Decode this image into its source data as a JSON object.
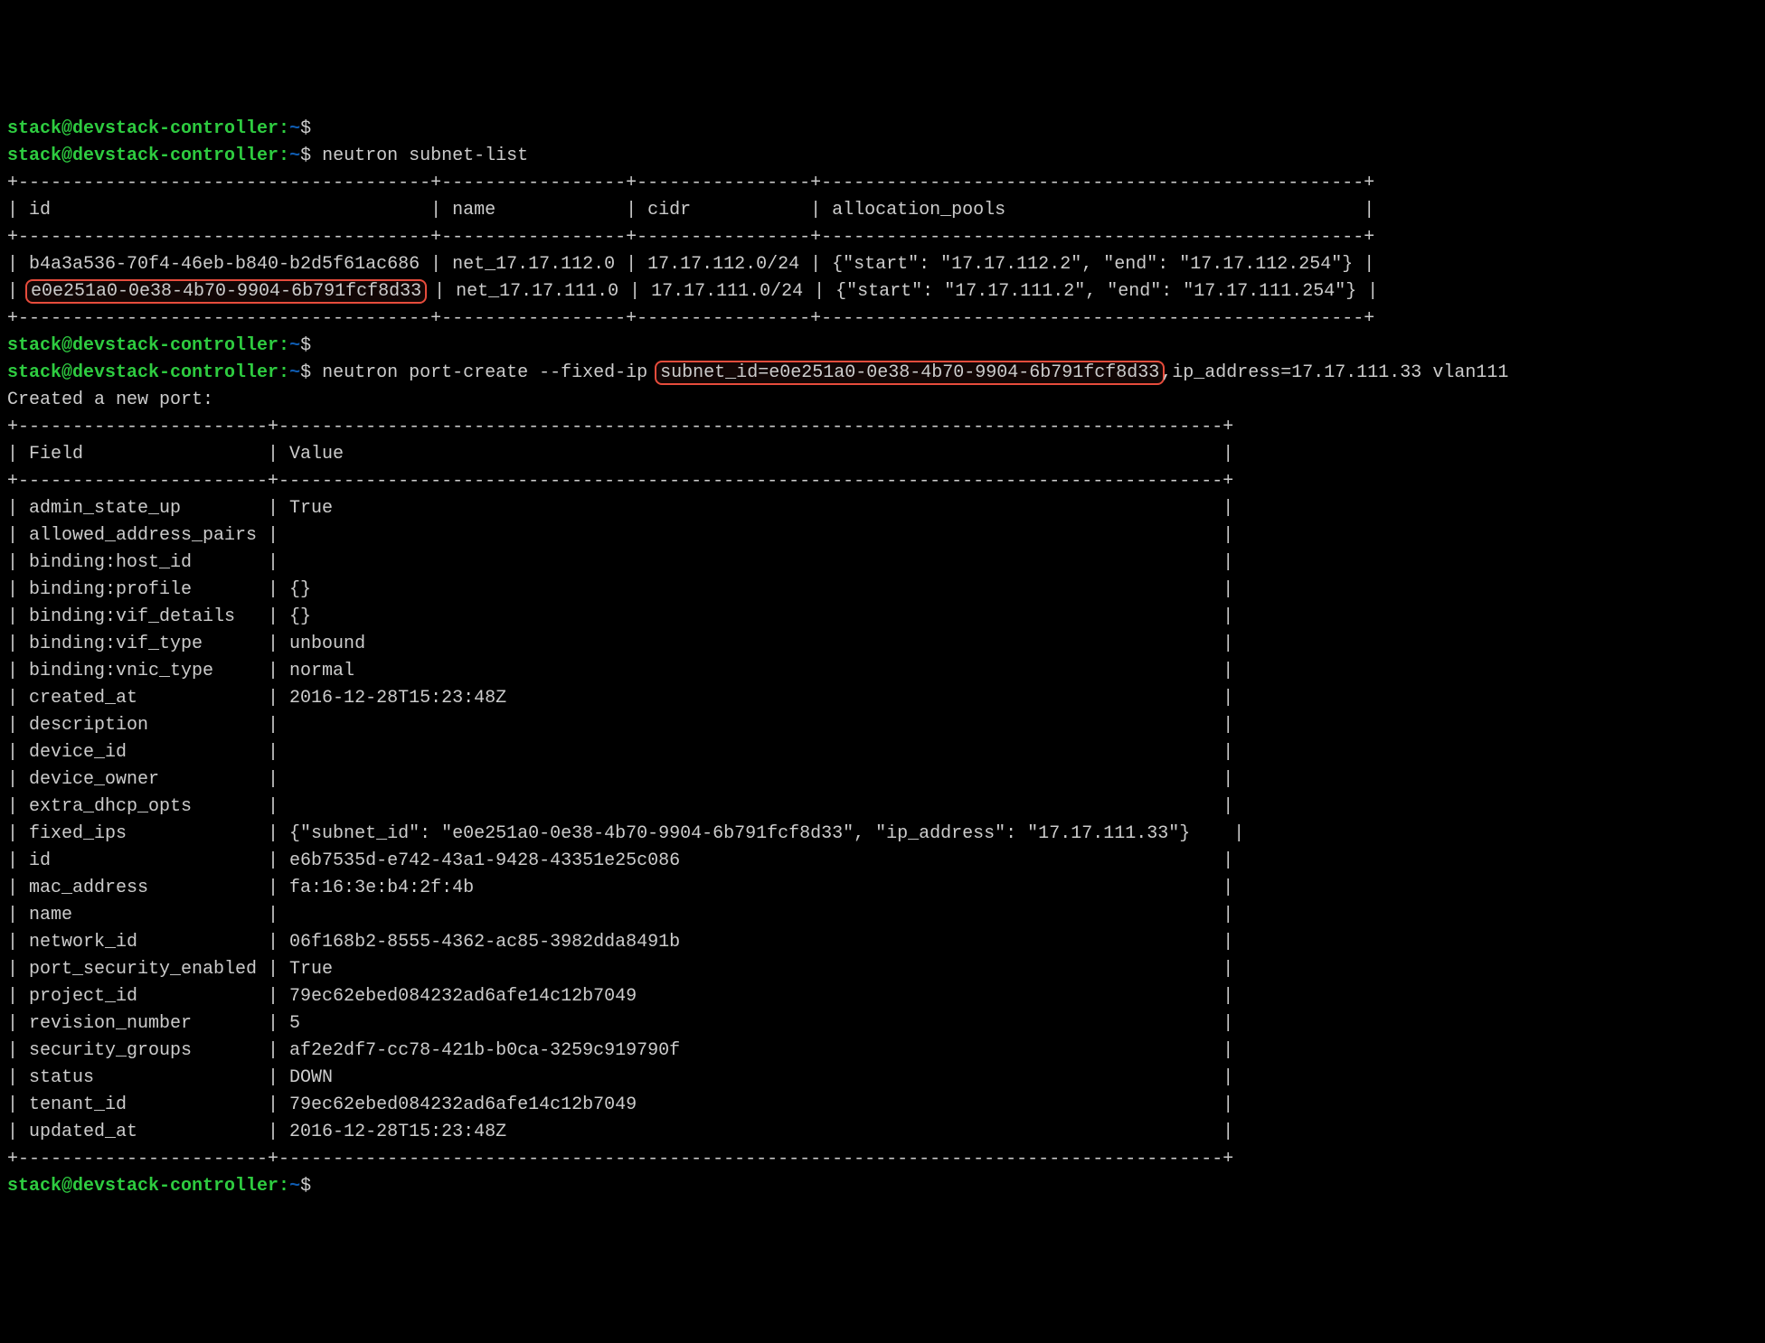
{
  "prompt": {
    "user_host": "stack@devstack-controller:",
    "path": "~",
    "dollar": "$"
  },
  "cmds": {
    "blank": "",
    "subnet_list": "neutron subnet-list",
    "port_create_prefix": "neutron port-create --fixed-ip ",
    "port_create_hl": "subnet_id=e0e251a0-0e38-4b70-9904-6b791fcf8d33",
    "port_create_suffix": ",ip_address=17.17.111.33 vlan111"
  },
  "subnet_table": {
    "border_top": "+--------------------------------------+-----------------+----------------+--------------------------------------------------+",
    "border_mid": "+--------------------------------------+-----------------+----------------+--------------------------------------------------+",
    "border_bot": "+--------------------------------------+-----------------+----------------+--------------------------------------------------+",
    "header": "| id                                   | name            | cidr           | allocation_pools                                 |",
    "row1": "| b4a3a536-70f4-46eb-b840-b2d5f61ac686 | net_17.17.112.0 | 17.17.112.0/24 | {\"start\": \"17.17.112.2\", \"end\": \"17.17.112.254\"} |",
    "row2_prefix": "| ",
    "row2_hl": "e0e251a0-0e38-4b70-9904-6b791fcf8d33",
    "row2_suffix": " | net_17.17.111.0 | 17.17.111.0/24 | {\"start\": \"17.17.111.2\", \"end\": \"17.17.111.254\"} |"
  },
  "port_created_msg": "Created a new port:",
  "port_table": {
    "border": "+-----------------------+---------------------------------------------------------------------------------------+",
    "header": "| Field                 | Value                                                                                 |",
    "rows": [
      "| admin_state_up        | True                                                                                  |",
      "| allowed_address_pairs |                                                                                       |",
      "| binding:host_id       |                                                                                       |",
      "| binding:profile       | {}                                                                                    |",
      "| binding:vif_details   | {}                                                                                    |",
      "| binding:vif_type      | unbound                                                                               |",
      "| binding:vnic_type     | normal                                                                                |",
      "| created_at            | 2016-12-28T15:23:48Z                                                                  |",
      "| description           |                                                                                       |",
      "| device_id             |                                                                                       |",
      "| device_owner          |                                                                                       |",
      "| extra_dhcp_opts       |                                                                                       |",
      "| fixed_ips             | {\"subnet_id\": \"e0e251a0-0e38-4b70-9904-6b791fcf8d33\", \"ip_address\": \"17.17.111.33\"}    |",
      "| id                    | e6b7535d-e742-43a1-9428-43351e25c086                                                  |",
      "| mac_address           | fa:16:3e:b4:2f:4b                                                                     |",
      "| name                  |                                                                                       |",
      "| network_id            | 06f168b2-8555-4362-ac85-3982dda8491b                                                  |",
      "| port_security_enabled | True                                                                                  |",
      "| project_id            | 79ec62ebed084232ad6afe14c12b7049                                                      |",
      "| revision_number       | 5                                                                                     |",
      "| security_groups       | af2e2df7-cc78-421b-b0ca-3259c919790f                                                  |",
      "| status                | DOWN                                                                                  |",
      "| tenant_id             | 79ec62ebed084232ad6afe14c12b7049                                                      |",
      "| updated_at            | 2016-12-28T15:23:48Z                                                                  |"
    ]
  }
}
